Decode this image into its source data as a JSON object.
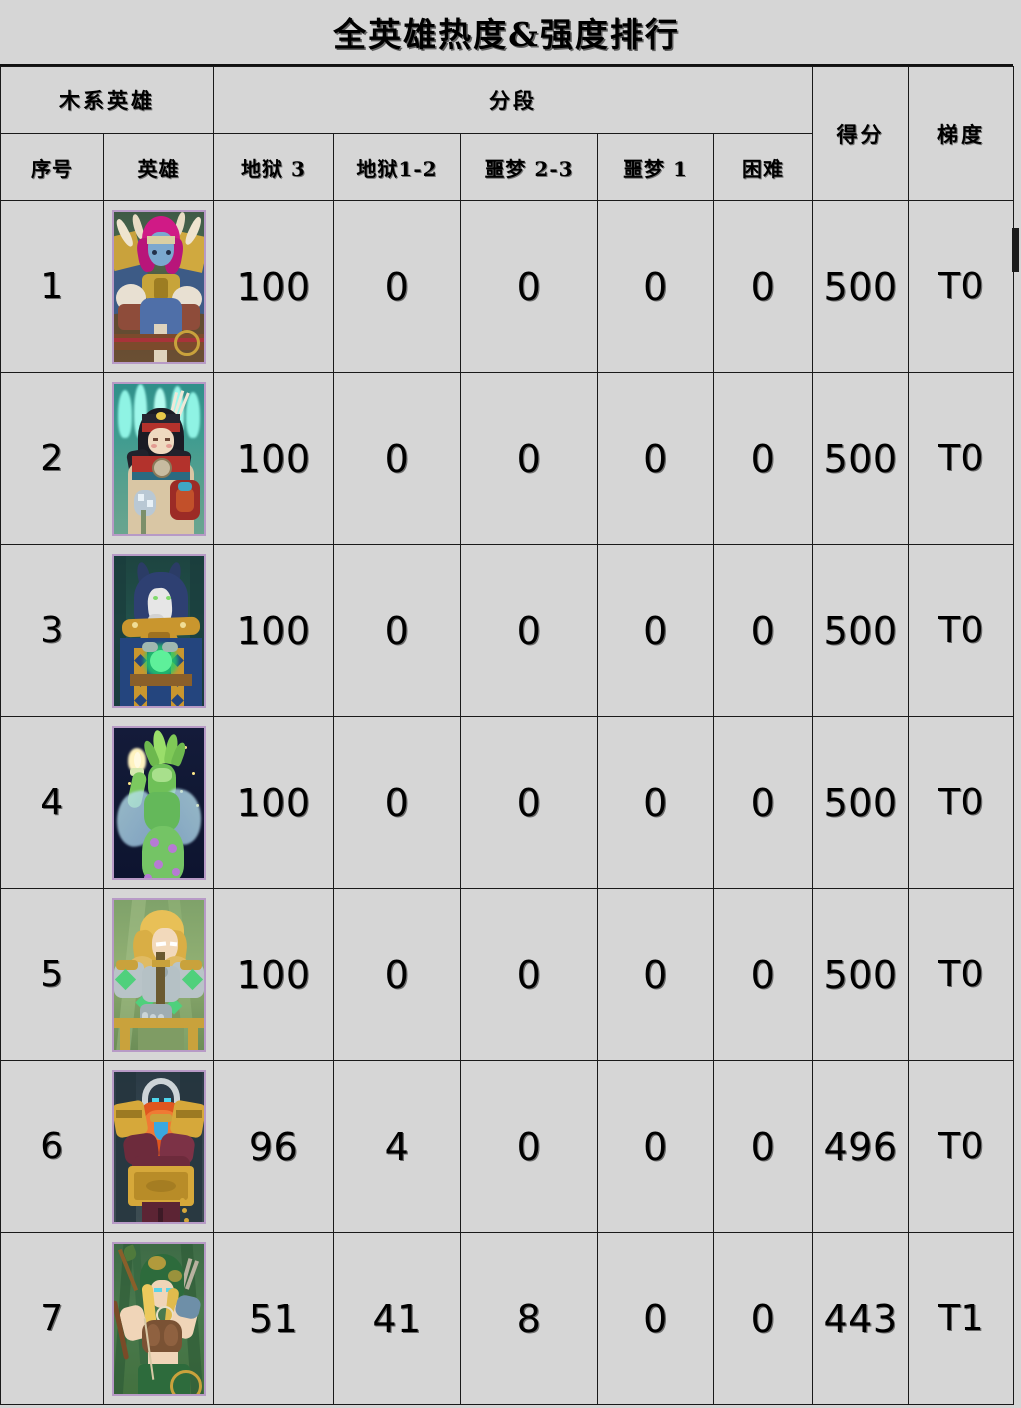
{
  "page": {
    "title": "全英雄热度&强度排行",
    "background_color": "#d6d6d6",
    "border_color": "#1a1a1a"
  },
  "header": {
    "group_left_label": "木系英雄",
    "group_segment_label": "分段",
    "score_label": "得分",
    "tier_label": "梯度",
    "columns": [
      {
        "key": "index",
        "label": "序号"
      },
      {
        "key": "hero",
        "label": "英雄"
      },
      {
        "key": "hell3",
        "label": "地狱 3"
      },
      {
        "key": "hell12",
        "label": "地狱1-2"
      },
      {
        "key": "nightmare23",
        "label": "噩梦 2-3"
      },
      {
        "key": "nightmare1",
        "label": "噩梦 1"
      },
      {
        "key": "hard",
        "label": "困难"
      },
      {
        "key": "score",
        "label": "得分"
      },
      {
        "key": "tier",
        "label": "梯度"
      }
    ]
  },
  "rows": [
    {
      "index": "1",
      "hero_art": "troll-viking-portrait",
      "hell3": "100",
      "hell12": "0",
      "nightmare23": "0",
      "nightmare1": "0",
      "hard": "0",
      "score": "500",
      "tier": "T0"
    },
    {
      "index": "2",
      "hero_art": "shaman-portrait",
      "hell3": "100",
      "hell12": "0",
      "nightmare23": "0",
      "nightmare1": "0",
      "hard": "0",
      "score": "500",
      "tier": "T0"
    },
    {
      "index": "3",
      "hero_art": "wolf-mage-portrait",
      "hell3": "100",
      "hell12": "0",
      "nightmare23": "0",
      "nightmare1": "0",
      "hard": "0",
      "score": "500",
      "tier": "T0"
    },
    {
      "index": "4",
      "hero_art": "dryad-portrait",
      "hell3": "100",
      "hell12": "0",
      "nightmare23": "0",
      "nightmare1": "0",
      "hard": "0",
      "score": "500",
      "tier": "T0"
    },
    {
      "index": "5",
      "hero_art": "knight-portrait",
      "hell3": "100",
      "hell12": "0",
      "nightmare23": "0",
      "nightmare1": "0",
      "hard": "0",
      "score": "500",
      "tier": "T0"
    },
    {
      "index": "6",
      "hero_art": "dwarf-portrait",
      "hell3": "96",
      "hell12": "4",
      "nightmare23": "0",
      "nightmare1": "0",
      "hard": "0",
      "score": "496",
      "tier": "T0"
    },
    {
      "index": "7",
      "hero_art": "archer-portrait",
      "hell3": "51",
      "hell12": "41",
      "nightmare23": "8",
      "nightmare1": "0",
      "hard": "0",
      "score": "443",
      "tier": "T1"
    }
  ]
}
